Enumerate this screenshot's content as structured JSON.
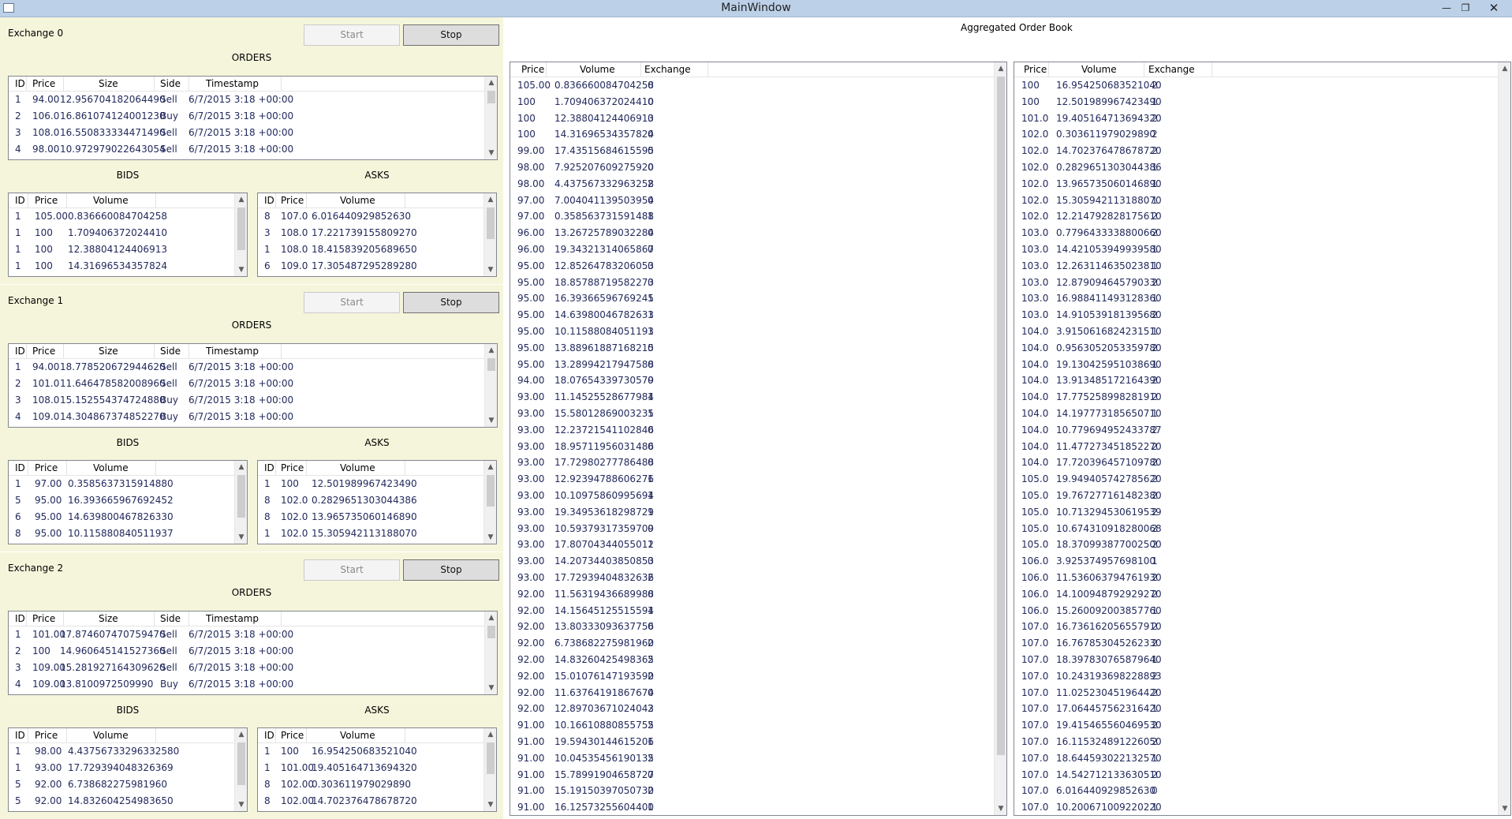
{
  "window": {
    "title": "MainWindow"
  },
  "order_headers": [
    "ID",
    "Price",
    "Size",
    "Side",
    "Timestamp"
  ],
  "book_headers": [
    "ID",
    "Price",
    "Volume"
  ],
  "agg_headers": [
    "Price",
    "Volume",
    "Exchange"
  ],
  "aggregated_title": "Aggregated Order Book",
  "exchanges": [
    {
      "name": "Exchange 0",
      "start_label": "Start",
      "stop_label": "Stop",
      "orders_title": "ORDERS",
      "bids_title": "BIDS",
      "asks_title": "ASKS",
      "orders": [
        [
          "1",
          "94.00",
          "12.956704182064490",
          "Sell",
          "6/7/2015 3:18  +00:00"
        ],
        [
          "2",
          "106.0",
          "16.861074124001230",
          "Buy",
          "6/7/2015 3:18  +00:00"
        ],
        [
          "3",
          "108.0",
          "16.550833334471490",
          "Sell",
          "6/7/2015 3:18  +00:00"
        ],
        [
          "4",
          "98.00",
          "10.972979022643054",
          "Sell",
          "6/7/2015 3:18  +00:00"
        ]
      ],
      "bids": [
        [
          "1",
          "105.00",
          "0.836660084704258"
        ],
        [
          "1",
          "100",
          "1.709406372024410"
        ],
        [
          "1",
          "100",
          "12.38804124406913"
        ],
        [
          "1",
          "100",
          "14.31696534357824"
        ]
      ],
      "asks": [
        [
          "8",
          "107.0",
          "6.016440929852630"
        ],
        [
          "3",
          "108.0",
          "17.221739155809270"
        ],
        [
          "1",
          "108.0",
          "18.415839205689650"
        ],
        [
          "6",
          "109.0",
          "17.305487295289280"
        ]
      ]
    },
    {
      "name": "Exchange 1",
      "start_label": "Start",
      "stop_label": "Stop",
      "orders_title": "ORDERS",
      "bids_title": "BIDS",
      "asks_title": "ASKS",
      "orders": [
        [
          "1",
          "94.00",
          "18.778520672944620",
          "Sell",
          "6/7/2015 3:18  +00:00"
        ],
        [
          "2",
          "101.0",
          "11.646478582008960",
          "Sell",
          "6/7/2015 3:18  +00:00"
        ],
        [
          "3",
          "108.0",
          "15.152554374724880",
          "Buy",
          "6/7/2015 3:18  +00:00"
        ],
        [
          "4",
          "109.0",
          "14.304867374852270",
          "Buy",
          "6/7/2015 3:18  +00:00"
        ]
      ],
      "bids": [
        [
          "1",
          "97.00",
          "0.3585637315914880"
        ],
        [
          "5",
          "95.00",
          "16.393665967692452"
        ],
        [
          "6",
          "95.00",
          "14.639800467826330"
        ],
        [
          "8",
          "95.00",
          "10.115880840511937"
        ]
      ],
      "asks": [
        [
          "1",
          "100",
          "12.501989967423490"
        ],
        [
          "8",
          "102.0",
          "0.2829651303044386"
        ],
        [
          "8",
          "102.0",
          "13.965735060146890"
        ],
        [
          "1",
          "102.0",
          "15.305942113188070"
        ]
      ]
    },
    {
      "name": "Exchange 2",
      "start_label": "Start",
      "stop_label": "Stop",
      "orders_title": "ORDERS",
      "bids_title": "BIDS",
      "asks_title": "ASKS",
      "orders": [
        [
          "1",
          "101.00",
          "17.874607470759470",
          "Sell",
          "6/7/2015 3:18  +00:00"
        ],
        [
          "2",
          "100",
          "14.960645141527360",
          "Sell",
          "6/7/2015 3:18  +00:00"
        ],
        [
          "3",
          "109.00",
          "15.281927164309620",
          "Sell",
          "6/7/2015 3:18  +00:00"
        ],
        [
          "4",
          "109.00",
          "13.8100972509990",
          "Buy",
          "6/7/2015 3:18  +00:00"
        ]
      ],
      "bids": [
        [
          "1",
          "98.00",
          "4.43756733296332580"
        ],
        [
          "1",
          "93.00",
          "17.729394048326369"
        ],
        [
          "5",
          "92.00",
          "6.738682275981960"
        ],
        [
          "5",
          "92.00",
          "14.832604254983650"
        ]
      ],
      "asks": [
        [
          "1",
          "100",
          "16.954250683521040"
        ],
        [
          "1",
          "101.00",
          "19.405164713694320"
        ],
        [
          "8",
          "102.00",
          "0.303611979029890"
        ],
        [
          "8",
          "102.00",
          "14.702376478678720"
        ]
      ]
    }
  ],
  "aggregated_bids": [
    [
      "105.00",
      "0.836660084704258",
      "0"
    ],
    [
      "100",
      "1.709406372024410",
      "0"
    ],
    [
      "100",
      "12.38804124406913",
      "0"
    ],
    [
      "100",
      "14.31696534357824",
      "0"
    ],
    [
      "99.00",
      "17.43515684615595",
      "0"
    ],
    [
      "98.00",
      "7.925207609275920",
      "0"
    ],
    [
      "98.00",
      "4.437567332963258",
      "2"
    ],
    [
      "97.00",
      "7.004041139503954",
      "0"
    ],
    [
      "97.00",
      "0.358563731591488",
      "1"
    ],
    [
      "96.00",
      "13.26725789032284",
      "0"
    ],
    [
      "96.00",
      "19.34321314065867",
      "0"
    ],
    [
      "95.00",
      "12.85264783206053",
      "0"
    ],
    [
      "95.00",
      "18.85788719582273",
      "0"
    ],
    [
      "95.00",
      "16.39366596769245",
      "1"
    ],
    [
      "95.00",
      "14.63980046782633",
      "1"
    ],
    [
      "95.00",
      "10.11588084051193",
      "1"
    ],
    [
      "95.00",
      "13.88961887168215",
      "0"
    ],
    [
      "95.00",
      "13.28994217947588",
      "0"
    ],
    [
      "94.00",
      "18.07654339730579",
      "0"
    ],
    [
      "93.00",
      "11.14525528677984",
      "1"
    ],
    [
      "93.00",
      "15.58012869003235",
      "1"
    ],
    [
      "93.00",
      "12.23721541102846",
      "0"
    ],
    [
      "93.00",
      "18.95711956031486",
      "0"
    ],
    [
      "93.00",
      "17.72980277786488",
      "0"
    ],
    [
      "93.00",
      "12.92394788606276",
      "1"
    ],
    [
      "93.00",
      "10.10975860995694",
      "1"
    ],
    [
      "93.00",
      "19.34953618298729",
      "1"
    ],
    [
      "93.00",
      "10.59379317359709",
      "0"
    ],
    [
      "93.00",
      "17.80704344055012",
      "1"
    ],
    [
      "93.00",
      "14.20734403850853",
      "0"
    ],
    [
      "93.00",
      "17.72939404832636",
      "2"
    ],
    [
      "92.00",
      "11.56319436689988",
      "0"
    ],
    [
      "92.00",
      "14.15645125515594",
      "1"
    ],
    [
      "92.00",
      "13.80333093637756",
      "0"
    ],
    [
      "92.00",
      "6.738682275981960",
      "2"
    ],
    [
      "92.00",
      "14.83260425498365",
      "2"
    ],
    [
      "92.00",
      "15.01076147193590",
      "2"
    ],
    [
      "92.00",
      "11.63764191867674",
      "0"
    ],
    [
      "92.00",
      "12.89703671024043",
      "2"
    ],
    [
      "91.00",
      "10.16610880855755",
      "2"
    ],
    [
      "91.00",
      "19.59430144615206",
      "1"
    ],
    [
      "91.00",
      "10.04535456190135",
      "2"
    ],
    [
      "91.00",
      "15.78991904658727",
      "0"
    ],
    [
      "91.00",
      "15.19150397050730",
      "2"
    ],
    [
      "91.00",
      "16.12573255604400",
      "1"
    ]
  ],
  "aggregated_asks": [
    [
      "100",
      "16.9542506835210​40",
      "2"
    ],
    [
      "100",
      "12.501989967423490",
      "1"
    ],
    [
      "101.0",
      "19.405164713694320",
      "2"
    ],
    [
      "102.0",
      "0.303611979029890",
      "2"
    ],
    [
      "102.0",
      "14.702376478678720",
      "2"
    ],
    [
      "102.0",
      "0.2829651303044386",
      "1"
    ],
    [
      "102.0",
      "13.965735060146890",
      "1"
    ],
    [
      "102.0",
      "15.305942113188070",
      "1"
    ],
    [
      "102.0",
      "12.214792828175610",
      "2"
    ],
    [
      "103.0",
      "0.7796433338800660",
      "2"
    ],
    [
      "103.0",
      "14.421053949939580",
      "1"
    ],
    [
      "103.0",
      "12.263114635023810",
      "1"
    ],
    [
      "103.0",
      "12.879094645790330",
      "2"
    ],
    [
      "103.0",
      "16.988411493128360",
      "1"
    ],
    [
      "103.0",
      "14.910539181395680",
      "2"
    ],
    [
      "104.0",
      "3.9150616824231510",
      "1"
    ],
    [
      "104.0",
      "0.9563052053359780",
      "2"
    ],
    [
      "104.0",
      "19.130425951038690",
      "1"
    ],
    [
      "104.0",
      "13.913485172164390",
      "2"
    ],
    [
      "104.0",
      "17.775258998281910",
      "2"
    ],
    [
      "104.0",
      "14.197773185650710",
      "1"
    ],
    [
      "104.0",
      "10.779694952433787",
      "2"
    ],
    [
      "104.0",
      "11.477273451852270",
      "2"
    ],
    [
      "104.0",
      "17.720396457109780",
      "2"
    ],
    [
      "105.0",
      "19.949405742785620",
      "2"
    ],
    [
      "105.0",
      "19.767277161482380",
      "2"
    ],
    [
      "105.0",
      "10.713294530619539",
      "2"
    ],
    [
      "105.0",
      "10.674310918280068",
      "2"
    ],
    [
      "105.0",
      "18.370993877002500",
      "2"
    ],
    [
      "106.0",
      "3.925374957698100",
      "1"
    ],
    [
      "106.0",
      "11.536063794761930",
      "2"
    ],
    [
      "106.0",
      "14.100948792929270",
      "2"
    ],
    [
      "106.0",
      "15.260092003857760",
      "1"
    ],
    [
      "107.0",
      "16.736162056557910",
      "2"
    ],
    [
      "107.0",
      "16.767853045262330",
      "2"
    ],
    [
      "107.0",
      "18.397830765879640",
      "1"
    ],
    [
      "107.0",
      "10.243193698228893",
      "2"
    ],
    [
      "107.0",
      "11.025230451964420",
      "2"
    ],
    [
      "107.0",
      "17.064457562316420",
      "1"
    ],
    [
      "107.0",
      "19.415465560469530",
      "2"
    ],
    [
      "107.0",
      "16.115324891226050",
      "2"
    ],
    [
      "107.0",
      "18.644593022132570",
      "1"
    ],
    [
      "107.0",
      "14.542712133630510",
      "2"
    ],
    [
      "107.0",
      "6.016440929852630",
      "0"
    ],
    [
      "107.0",
      "10.200671009220220",
      "1"
    ]
  ]
}
